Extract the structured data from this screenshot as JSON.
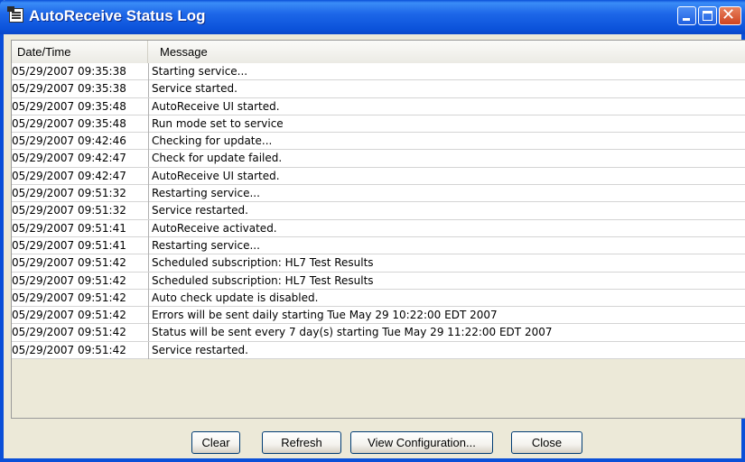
{
  "window": {
    "title": "AutoReceive Status Log"
  },
  "columns": {
    "datetime": "Date/Time",
    "message": "Message"
  },
  "rows": [
    {
      "datetime": "05/29/2007 09:35:38",
      "message": "Starting service..."
    },
    {
      "datetime": "05/29/2007 09:35:38",
      "message": "Service started."
    },
    {
      "datetime": "05/29/2007 09:35:48",
      "message": "AutoReceive UI started."
    },
    {
      "datetime": "05/29/2007 09:35:48",
      "message": "Run mode set to service"
    },
    {
      "datetime": "05/29/2007 09:42:46",
      "message": "Checking for update..."
    },
    {
      "datetime": "05/29/2007 09:42:47",
      "message": "Check for update failed."
    },
    {
      "datetime": "05/29/2007 09:42:47",
      "message": "AutoReceive UI started."
    },
    {
      "datetime": "05/29/2007 09:51:32",
      "message": "Restarting service..."
    },
    {
      "datetime": "05/29/2007 09:51:32",
      "message": "Service restarted."
    },
    {
      "datetime": "05/29/2007 09:51:41",
      "message": "AutoReceive activated."
    },
    {
      "datetime": "05/29/2007 09:51:41",
      "message": "Restarting service..."
    },
    {
      "datetime": "05/29/2007 09:51:42",
      "message": "Scheduled subscription: HL7 Test Results"
    },
    {
      "datetime": "05/29/2007 09:51:42",
      "message": "Scheduled subscription: HL7 Test Results"
    },
    {
      "datetime": "05/29/2007 09:51:42",
      "message": "Auto check update is disabled."
    },
    {
      "datetime": "05/29/2007 09:51:42",
      "message": "Errors will be sent daily starting Tue May 29 10:22:00 EDT 2007"
    },
    {
      "datetime": "05/29/2007 09:51:42",
      "message": "Status will be sent every 7 day(s) starting Tue May 29 11:22:00 EDT 2007"
    },
    {
      "datetime": "05/29/2007 09:51:42",
      "message": "Service restarted."
    }
  ],
  "buttons": {
    "clear": "Clear",
    "refresh": "Refresh",
    "view_configuration": "View Configuration...",
    "close": "Close"
  },
  "icons": {
    "app": "log-document-icon",
    "minimize": "minimize-icon",
    "maximize": "maximize-icon",
    "close": "close-icon"
  },
  "colors": {
    "titlebar": "#0b52da",
    "close_button": "#cf4420",
    "window_background": "#ece9d8"
  }
}
